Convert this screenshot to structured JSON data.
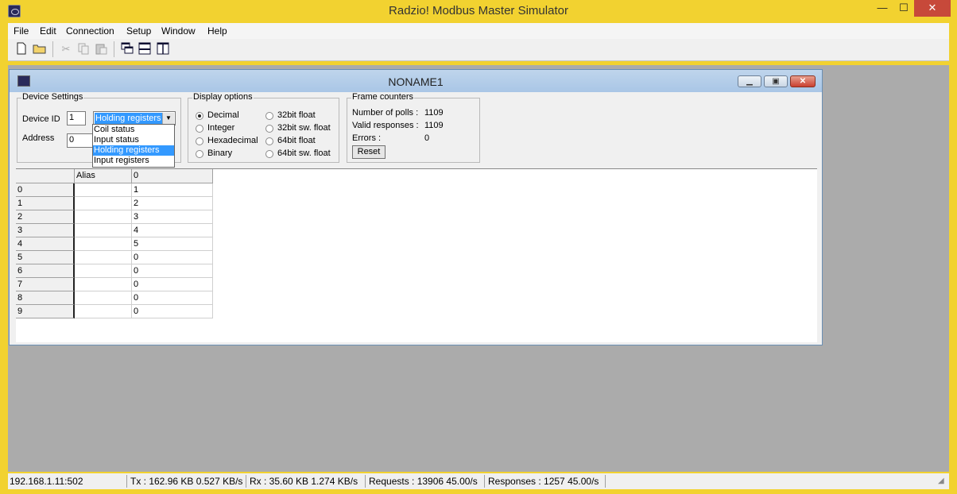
{
  "window": {
    "title": "Radzio! Modbus Master Simulator",
    "min": "—",
    "max": "☐",
    "close": "✕"
  },
  "menu": [
    "File",
    "Edit",
    "Connection",
    "Setup",
    "Window",
    "Help"
  ],
  "toolbar_icons": [
    "new-file-icon",
    "open-folder-icon",
    "cut-icon",
    "copy-icon",
    "paste-icon",
    "cascade-icon",
    "tile-horizontal-icon",
    "tile-vertical-icon"
  ],
  "child": {
    "title": "NONAME1",
    "min": "▁",
    "max": "▣",
    "close": "✕"
  },
  "device_settings": {
    "legend": "Device Settings",
    "device_id_label": "Device ID",
    "device_id_value": "1",
    "address_label": "Address",
    "address_value": "0",
    "register_type": "Holding registers",
    "register_options": [
      "Coil status",
      "Input status",
      "Holding registers",
      "Input registers"
    ]
  },
  "display_options": {
    "legend": "Display options",
    "left": [
      "Decimal",
      "Integer",
      "Hexadecimal",
      "Binary"
    ],
    "right": [
      "32bit float",
      "32bit sw. float",
      "64bit float",
      "64bit sw. float"
    ],
    "selected": "Decimal"
  },
  "frame_counters": {
    "legend": "Frame counters",
    "polls_label": "Number of polls :",
    "polls_value": "1109",
    "valid_label": "Valid responses :",
    "valid_value": "1109",
    "errors_label": "Errors :",
    "errors_value": "0",
    "reset_label": "Reset"
  },
  "grid": {
    "headers": [
      "",
      "Alias",
      "0"
    ],
    "rows": [
      {
        "index": "0",
        "alias": "",
        "value": "1"
      },
      {
        "index": "1",
        "alias": "",
        "value": "2"
      },
      {
        "index": "2",
        "alias": "",
        "value": "3"
      },
      {
        "index": "3",
        "alias": "",
        "value": "4"
      },
      {
        "index": "4",
        "alias": "",
        "value": "5"
      },
      {
        "index": "5",
        "alias": "",
        "value": "0"
      },
      {
        "index": "6",
        "alias": "",
        "value": "0"
      },
      {
        "index": "7",
        "alias": "",
        "value": "0"
      },
      {
        "index": "8",
        "alias": "",
        "value": "0"
      },
      {
        "index": "9",
        "alias": "",
        "value": "0"
      }
    ]
  },
  "status": [
    "192.168.1.11:502",
    "Tx : 162.96 KB   0.527 KB/s",
    "Rx : 35.60 KB   1.274 KB/s",
    "Requests : 13906   45.00/s",
    "Responses : 1257   45.00/s"
  ],
  "colors": {
    "app_frame": "#f2d230",
    "mdi_background": "#ababab",
    "selection": "#3399ff"
  }
}
